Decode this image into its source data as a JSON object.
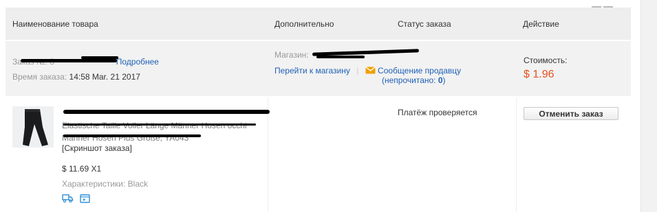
{
  "table_header": {
    "col_product": "Наименование товара",
    "col_additional": "Дополнительно",
    "col_status": "Статус заказа",
    "col_action": "Действие"
  },
  "order": {
    "order_no_label": "Заказ №:",
    "order_no_partial": "8",
    "details_link": "Подробнее",
    "order_time_label": "Время заказа:",
    "order_time_value": "14:58 Mar. 21 2017",
    "store_label": "Магазин:",
    "goto_store_link": "Перейти к магазину",
    "message_seller_link": "Сообщение продавцу",
    "unread_prefix": "(непрочитано: ",
    "unread_count": "0",
    "unread_suffix": ")",
    "cost_label": "Стоимость:",
    "cost_value": "$ 1.96"
  },
  "item": {
    "title_lines": [
      "Elastische Taille Voller Länge Männer Hosen occhi",
      "Männer Hosen Plus Größe, YA043"
    ],
    "screenshot_link": "[Скриншот заказа]",
    "price_qty": "$ 11.69 X1",
    "attributes_label": "Характеристики:",
    "attributes_value": "Black",
    "status": "Платёж проверяется",
    "cancel_button": "Отменить заказ"
  },
  "icons": {
    "envelope": "envelope-icon",
    "delivery": "delivery-truck-icon",
    "snapshot": "snapshot-icon"
  },
  "colors": {
    "price": "#e5511d",
    "link": "#2061b5",
    "header_bg": "#eeeeee",
    "summary_bg": "#f2f2f2",
    "envelope": "#f0a000"
  }
}
